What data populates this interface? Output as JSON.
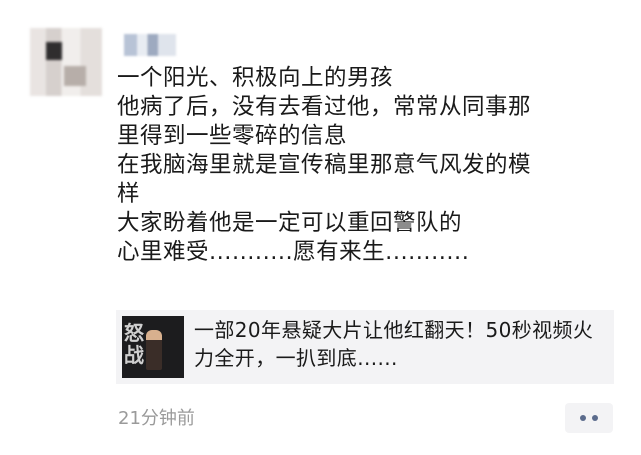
{
  "post": {
    "lines": [
      "一个阳光、积极向上的男孩",
      "他病了后，没有去看过他，常常从同事那",
      "里得到一些零碎的信息",
      "在我脑海里就是宣传稿里那意气风发的模",
      "样",
      "大家盼着他是一定可以重回警队的",
      "心里难受...........愿有来生..........."
    ]
  },
  "share_card": {
    "title": "一部20年悬疑大片让他红翻天！50秒视频火力全开，一扒到底......",
    "thumbnail_text": "怒战",
    "thumbnail_icon": "video-thumbnail"
  },
  "timestamp": "21分钟前",
  "more_button": {
    "icon": "more-dots-icon"
  },
  "colors": {
    "text": "#1a1a1a",
    "muted": "#9a9a9a",
    "card_bg": "#f3f3f5",
    "link_dots": "#5b6b8c"
  }
}
